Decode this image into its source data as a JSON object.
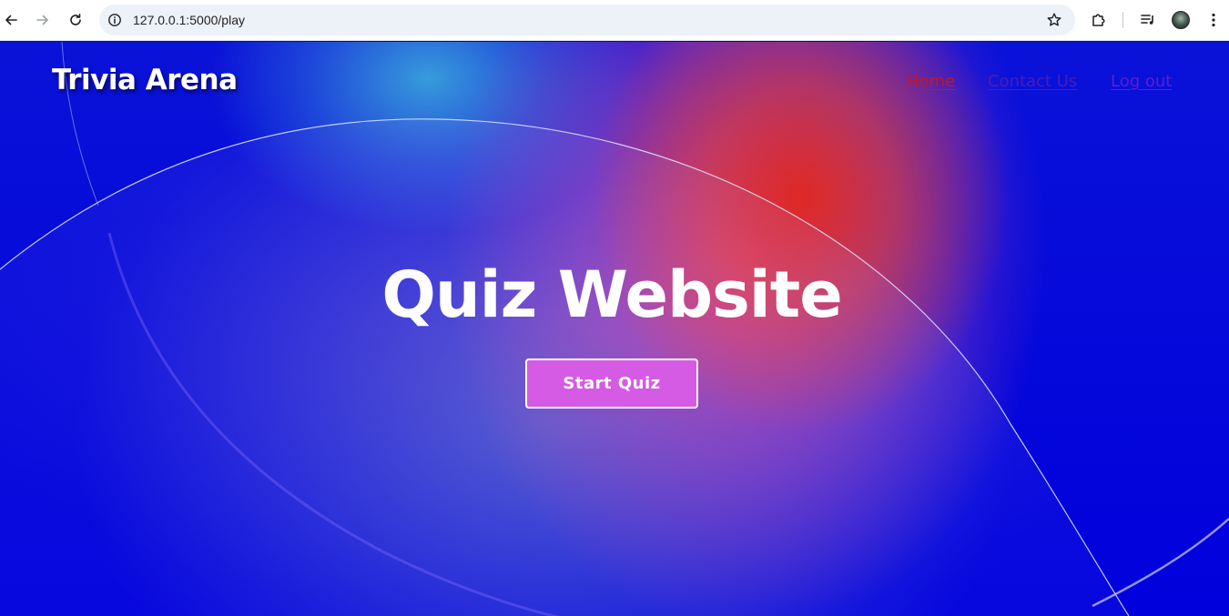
{
  "browser": {
    "url": "127.0.0.1:5000/play",
    "icons": {
      "back": "arrow-left-icon",
      "forward": "arrow-right-icon",
      "reload": "reload-icon",
      "site_info": "info-icon",
      "bookmark": "star-icon",
      "extensions": "puzzle-icon",
      "media": "playlist-icon",
      "profile": "avatar",
      "menu": "kebab-menu-icon"
    }
  },
  "site": {
    "title": "Trivia Arena",
    "nav": {
      "home": "Home",
      "contact": "Contact Us",
      "logout": "Log out"
    }
  },
  "hero": {
    "title": "Quiz Website",
    "cta": "Start Quiz"
  },
  "colors": {
    "background": "#0000d8",
    "nav_home": "#c4171f",
    "nav_contact": "#4a1cb6",
    "nav_logout": "#6d1fd1",
    "button_bg": "#d55ae4",
    "button_border": "#ffffff"
  }
}
